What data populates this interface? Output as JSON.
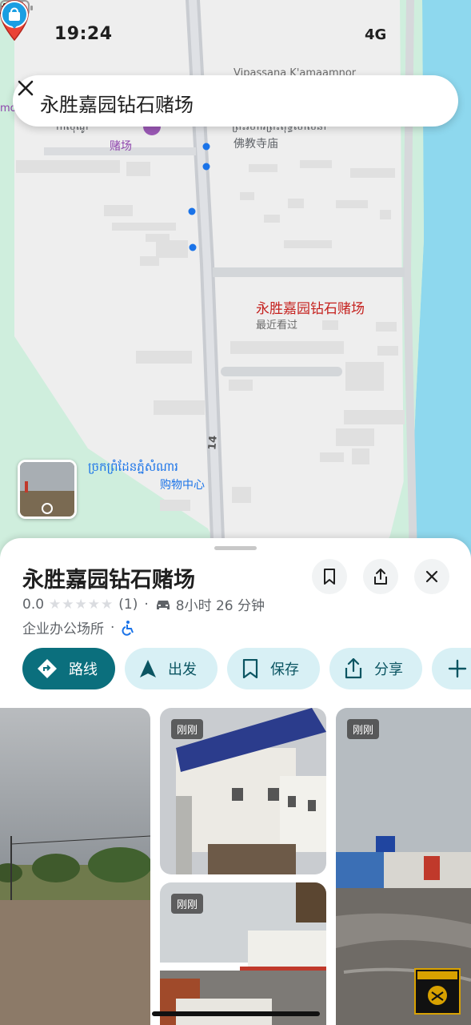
{
  "status_bar": {
    "time": "19:24",
    "network": "4G"
  },
  "search": {
    "query": "永胜嘉园钻石赌场"
  },
  "map": {
    "labels": {
      "top_roman": "Vipassana K'amaamnor",
      "temple_kh": "ព្រះវិហារព្រះពុទ្ធសាសនា",
      "temple_zh": "佛教寺庙",
      "casino_kh": "កាស៊ីណូ",
      "casino_zh": "赌场",
      "left_edge": "mo",
      "mall_kh": "ច្រកព្រំដែនភ្នំសំណារ",
      "mall_zh": "购物中心",
      "road_number": "14"
    },
    "pin": {
      "title": "永胜嘉园钻石赌场",
      "subtitle": "最近看过"
    },
    "colors": {
      "land": "#cfeedd",
      "urban": "#eeeeee",
      "water": "#8ed8ee",
      "pin": "#ea4335"
    }
  },
  "place": {
    "title": "永胜嘉园钻石赌场",
    "rating": "0.0",
    "stars_filled": 0,
    "review_count": "(1)",
    "separator": "·",
    "drive_time": "8小时 26 分钟",
    "category": "企业办公场所",
    "buttons": {
      "route": "路线",
      "start": "出发",
      "save": "保存",
      "share": "分享"
    }
  },
  "photos": [
    {
      "badge": ""
    },
    {
      "badge": "刚刚"
    },
    {
      "badge": "刚刚"
    },
    {
      "badge": "刚刚"
    }
  ],
  "icons": [
    "location-arrow-icon",
    "signal-icon",
    "battery-icon",
    "close-icon",
    "bookmark-icon",
    "share-icon",
    "car-icon",
    "wheelchair-icon",
    "directions-icon",
    "navigate-icon",
    "plus-icon",
    "pin-icon",
    "shopping-bag-icon"
  ]
}
